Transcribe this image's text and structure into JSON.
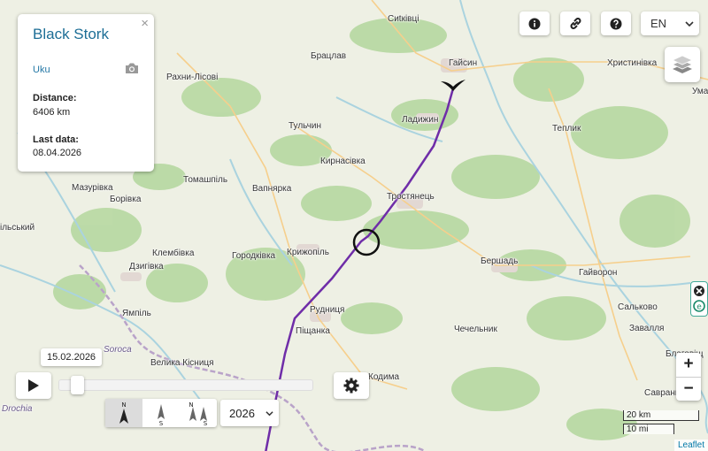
{
  "panel": {
    "title": "Black Stork",
    "name": "Uku",
    "distance_label": "Distance:",
    "distance_value": "6406 km",
    "last_label": "Last data:",
    "last_value": "08.04.2026",
    "close": "×"
  },
  "toolbar": {
    "language": "EN",
    "info_icon": "info-icon",
    "link_icon": "link-icon",
    "help_icon": "help-icon"
  },
  "map": {
    "places": [
      "Сиtківці",
      "Брацлав",
      "Гайсин",
      "Христинівка",
      "Умань",
      "Рахни-Лісові",
      "Ладижин",
      "Тульчин",
      "Теплик",
      "Кирнасівка",
      "Мазурівка",
      "Томашпіль",
      "Вапнярка",
      "Тростянець",
      "Борівка",
      "Крижопіль",
      "Бершадь",
      "Городківка",
      "Клембівка",
      "Гайворон",
      "Дзигівка",
      "Ямпіль",
      "Рудниця",
      "Сальково",
      "Піщанка",
      "Чечельник",
      "Завалля",
      "Soroca",
      "Велика Кісниця",
      "Кодима",
      "Саврань",
      "Drochia",
      "Благовіщ",
      "ільський"
    ]
  },
  "controls": {
    "date": "15.02.2026",
    "year": "2026",
    "progress": 0.05,
    "dir_buttons": [
      {
        "top": "N",
        "bottom": ""
      },
      {
        "top": "",
        "bottom": "S"
      },
      {
        "top": "N",
        "bottom": "S"
      }
    ],
    "zoom_in": "+",
    "zoom_out": "−"
  },
  "scale": {
    "km": "20 km",
    "mi": "10 mi"
  },
  "attribution": "Leaflet",
  "colors": {
    "track": "#6f2da8",
    "title": "#1d6e96",
    "water": "#aad3df",
    "forest": "#b9d9a4"
  }
}
